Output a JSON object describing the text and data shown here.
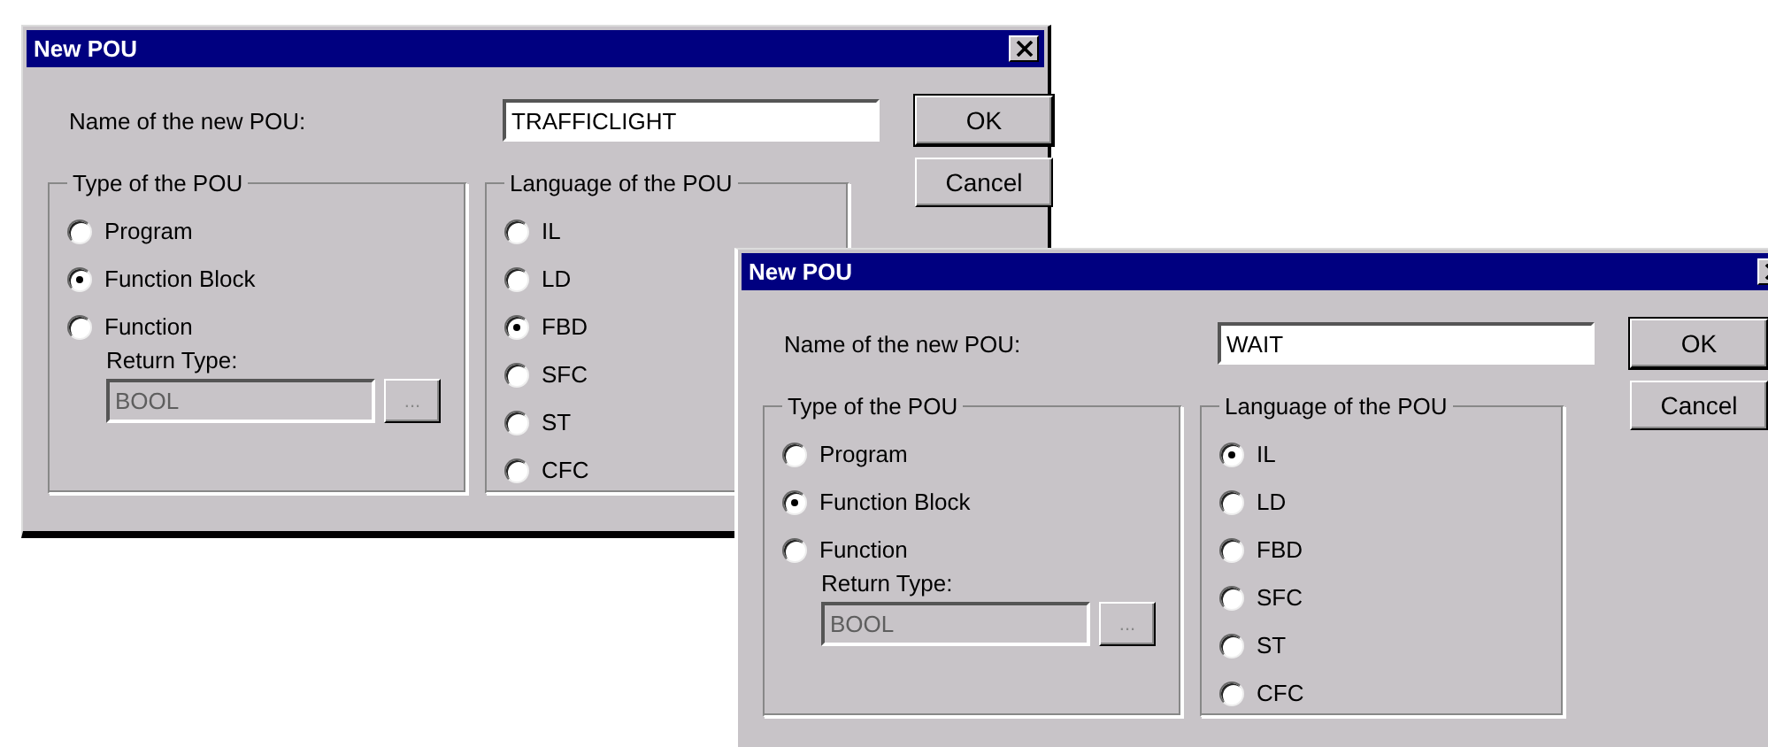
{
  "dialogs": [
    {
      "title": "New POU",
      "name_label": "Name of the new POU:",
      "name_value": "TRAFFICLIGHT",
      "buttons": [
        "OK",
        "Cancel"
      ],
      "type_group": {
        "title": "Type of the POU",
        "options": [
          {
            "label": "Program",
            "selected": false
          },
          {
            "label": "Function Block",
            "selected": true
          },
          {
            "label": "Function",
            "selected": false
          }
        ],
        "return_type_label": "Return Type:",
        "return_type_value": "BOOL",
        "disabled": true,
        "browse_button": "..."
      },
      "language_group": {
        "title": "Language of the POU",
        "options": [
          {
            "label": "IL",
            "selected": false
          },
          {
            "label": "LD",
            "selected": false
          },
          {
            "label": "FBD",
            "selected": true
          },
          {
            "label": "SFC",
            "selected": false
          },
          {
            "label": "ST",
            "selected": false
          },
          {
            "label": "CFC",
            "selected": false
          }
        ]
      }
    },
    {
      "title": "New POU",
      "name_label": "Name of the new POU:",
      "name_value": "WAIT",
      "buttons": [
        "OK",
        "Cancel"
      ],
      "type_group": {
        "title": "Type of the POU",
        "options": [
          {
            "label": "Program",
            "selected": false
          },
          {
            "label": "Function Block",
            "selected": true
          },
          {
            "label": "Function",
            "selected": false
          }
        ],
        "return_type_label": "Return Type:",
        "return_type_value": "BOOL",
        "disabled": true,
        "browse_button": "..."
      },
      "language_group": {
        "title": "Language of the POU",
        "options": [
          {
            "label": "IL",
            "selected": true
          },
          {
            "label": "LD",
            "selected": false
          },
          {
            "label": "FBD",
            "selected": false
          },
          {
            "label": "SFC",
            "selected": false
          },
          {
            "label": "ST",
            "selected": false
          },
          {
            "label": "CFC",
            "selected": false
          }
        ]
      }
    }
  ]
}
